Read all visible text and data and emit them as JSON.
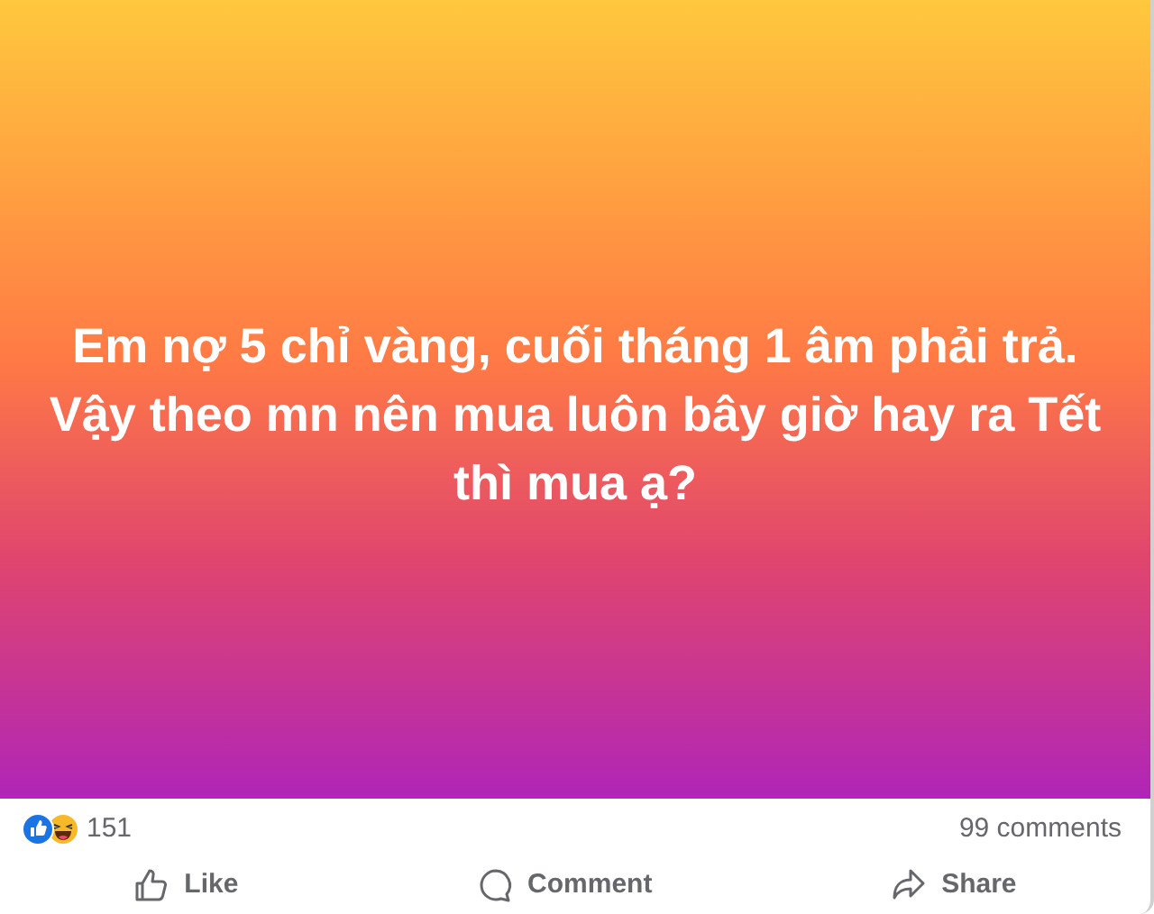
{
  "post": {
    "text": "Em nợ 5 chỉ vàng, cuối tháng 1 âm phải trả. Vậy theo mn nên mua luôn bây giờ hay ra Tết thì mua ạ?"
  },
  "reactions": {
    "count": "151",
    "types": [
      {
        "kind": "like"
      },
      {
        "kind": "haha"
      }
    ]
  },
  "comments_count": "99 comments",
  "actions": [
    {
      "kind": "like",
      "label": "Like"
    },
    {
      "kind": "comment",
      "label": "Comment"
    },
    {
      "kind": "share",
      "label": "Share"
    }
  ]
}
